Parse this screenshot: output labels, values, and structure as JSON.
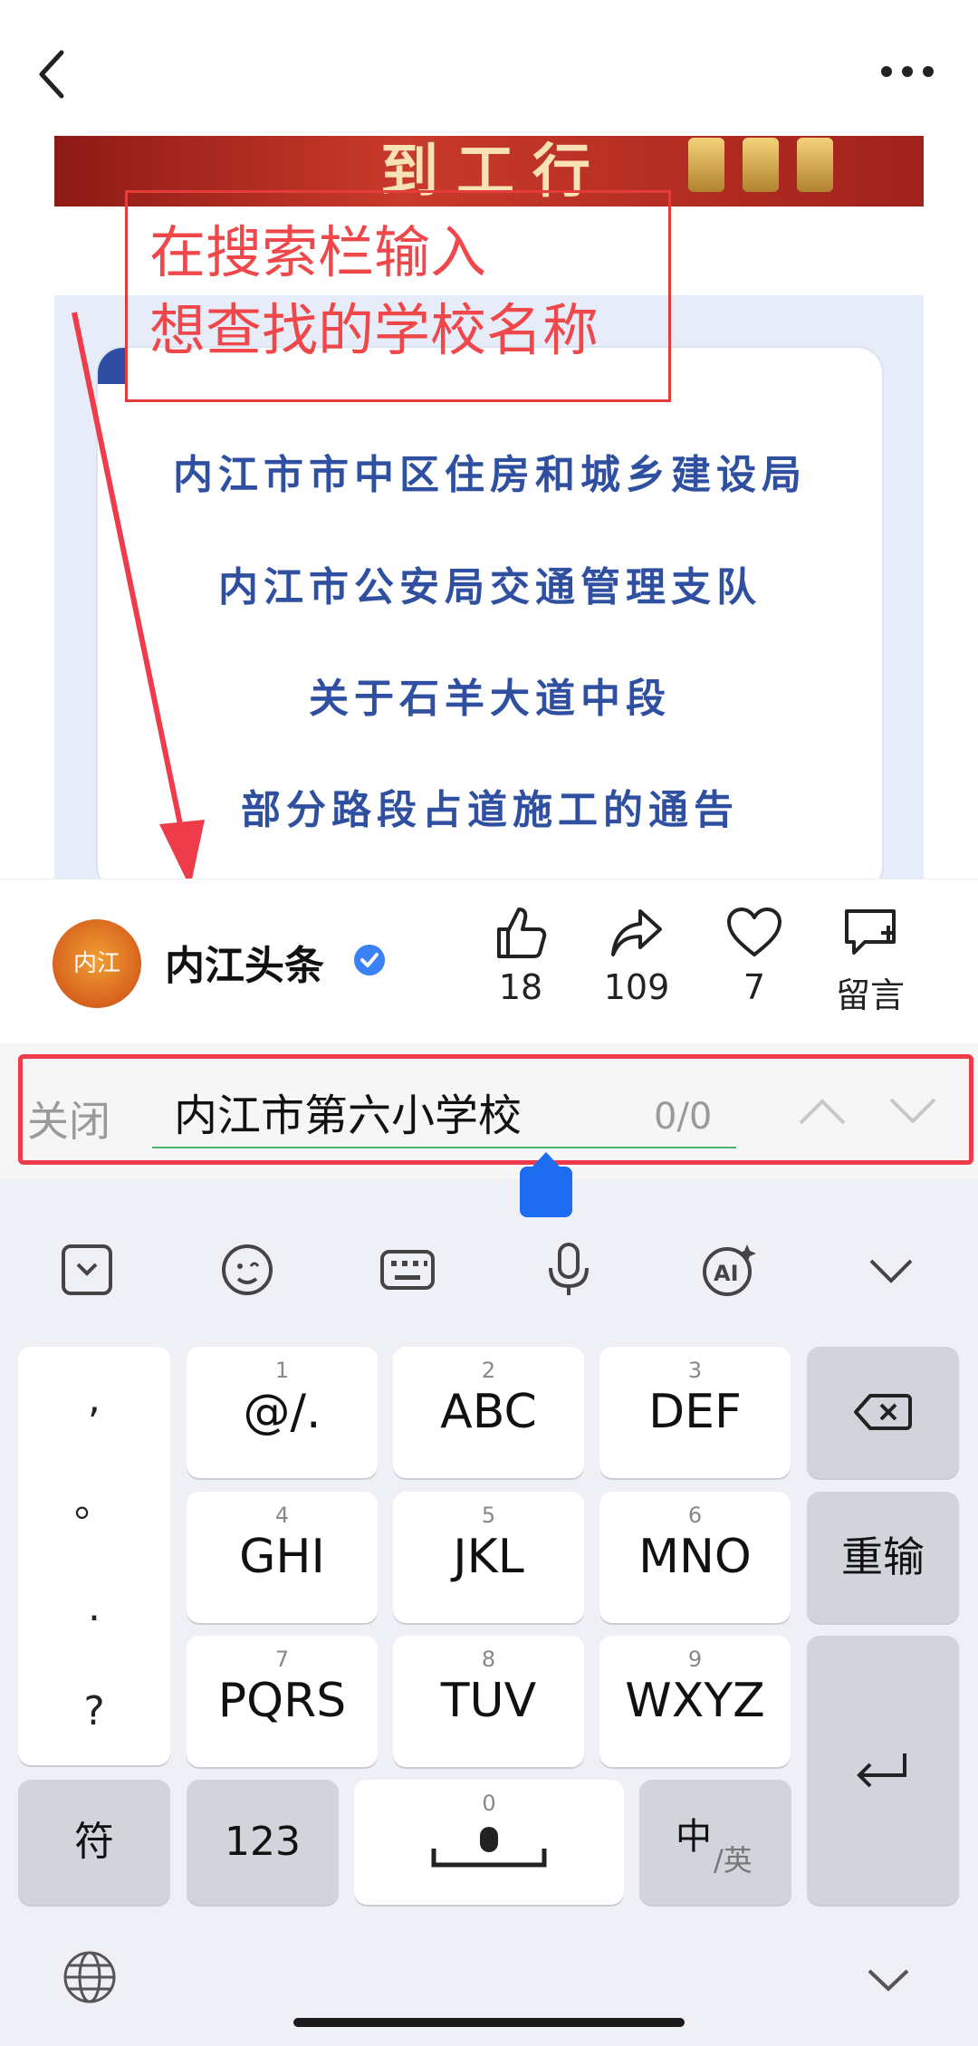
{
  "banner": {
    "partial_text": "到工行"
  },
  "article": {
    "lines": [
      "内江市市中区住房和城乡建设局",
      "内江市公安局交通管理支队",
      "关于石羊大道中段",
      "部分路段占道施工的通告"
    ]
  },
  "annotation": {
    "line1": "在搜索栏输入",
    "line2": "想查找的学校名称"
  },
  "account": {
    "name": "内江头条",
    "avatar_text": "内江",
    "likes": "18",
    "shares": "109",
    "favorites": "7",
    "comment_label": "留言"
  },
  "search": {
    "close_label": "关闭",
    "value": "内江市第六小学校",
    "count": "0/0"
  },
  "keyboard": {
    "punct": [
      ",",
      "。",
      ".",
      "?"
    ],
    "rows": [
      [
        {
          "num": "1",
          "label": "@/."
        },
        {
          "num": "2",
          "label": "ABC"
        },
        {
          "num": "3",
          "label": "DEF"
        }
      ],
      [
        {
          "num": "4",
          "label": "GHI"
        },
        {
          "num": "5",
          "label": "JKL"
        },
        {
          "num": "6",
          "label": "MNO"
        }
      ],
      [
        {
          "num": "7",
          "label": "PQRS"
        },
        {
          "num": "8",
          "label": "TUV"
        },
        {
          "num": "9",
          "label": "WXYZ"
        }
      ]
    ],
    "retype": "重输",
    "symbol": "符",
    "numbers": "123",
    "space_num": "0",
    "lang_main": "中",
    "lang_sub": "/英"
  },
  "colors": {
    "accent_red": "#ef3c4a",
    "doc_blue": "#2f4fa0",
    "verified_blue": "#3b82f6"
  }
}
